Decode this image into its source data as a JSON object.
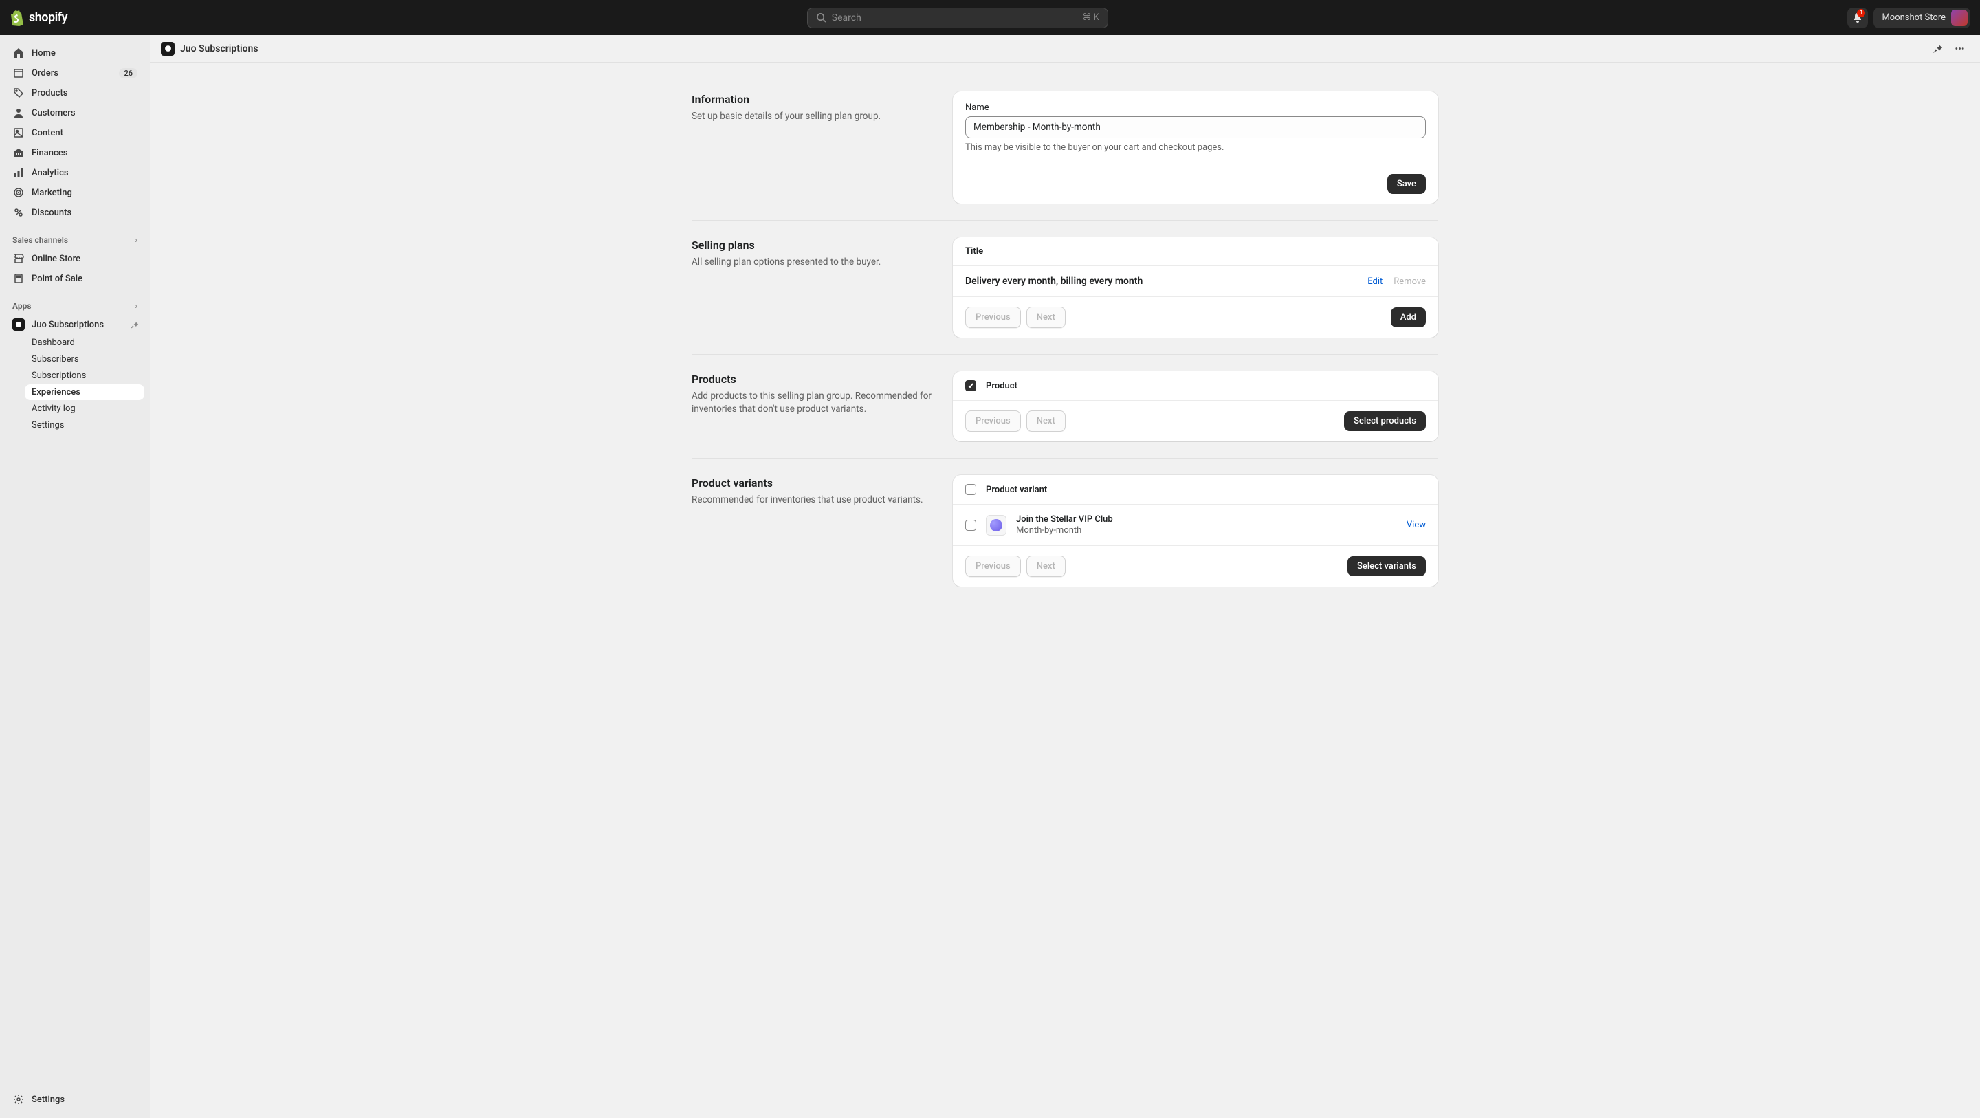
{
  "topbar": {
    "search_placeholder": "Search",
    "search_shortcut": "⌘ K",
    "notification_count": "1",
    "store_name": "Moonshot Store"
  },
  "sidebar": {
    "items": [
      {
        "label": "Home"
      },
      {
        "label": "Orders",
        "badge": "26"
      },
      {
        "label": "Products"
      },
      {
        "label": "Customers"
      },
      {
        "label": "Content"
      },
      {
        "label": "Finances"
      },
      {
        "label": "Analytics"
      },
      {
        "label": "Marketing"
      },
      {
        "label": "Discounts"
      }
    ],
    "sales_channels_label": "Sales channels",
    "channels": [
      {
        "label": "Online Store"
      },
      {
        "label": "Point of Sale"
      }
    ],
    "apps_label": "Apps",
    "apps": [
      {
        "label": "Juo Subscriptions"
      }
    ],
    "app_sub": [
      {
        "label": "Dashboard"
      },
      {
        "label": "Subscribers"
      },
      {
        "label": "Subscriptions"
      },
      {
        "label": "Experiences"
      },
      {
        "label": "Activity log"
      },
      {
        "label": "Settings"
      }
    ],
    "settings_label": "Settings"
  },
  "page": {
    "title": "Juo Subscriptions"
  },
  "information": {
    "heading": "Information",
    "description": "Set up basic details of your selling plan group.",
    "name_label": "Name",
    "name_value": "Membership - Month-by-month",
    "name_help": "This may be visible to the buyer on your cart and checkout pages.",
    "save_label": "Save"
  },
  "selling_plans": {
    "heading": "Selling plans",
    "description": "All selling plan options presented to the buyer.",
    "title_col": "Title",
    "row_title": "Delivery every month, billing every month",
    "edit_label": "Edit",
    "remove_label": "Remove",
    "prev_label": "Previous",
    "next_label": "Next",
    "add_label": "Add"
  },
  "products": {
    "heading": "Products",
    "description": "Add products to this selling plan group. Recommended for inventories that don't use product variants.",
    "product_col": "Product",
    "prev_label": "Previous",
    "next_label": "Next",
    "select_label": "Select products"
  },
  "variants": {
    "heading": "Product variants",
    "description": "Recommended for inventories that use product variants.",
    "variant_col": "Product variant",
    "item_title": "Join the Stellar VIP Club",
    "item_sub": "Month-by-month",
    "view_label": "View",
    "prev_label": "Previous",
    "next_label": "Next",
    "select_label": "Select variants"
  }
}
